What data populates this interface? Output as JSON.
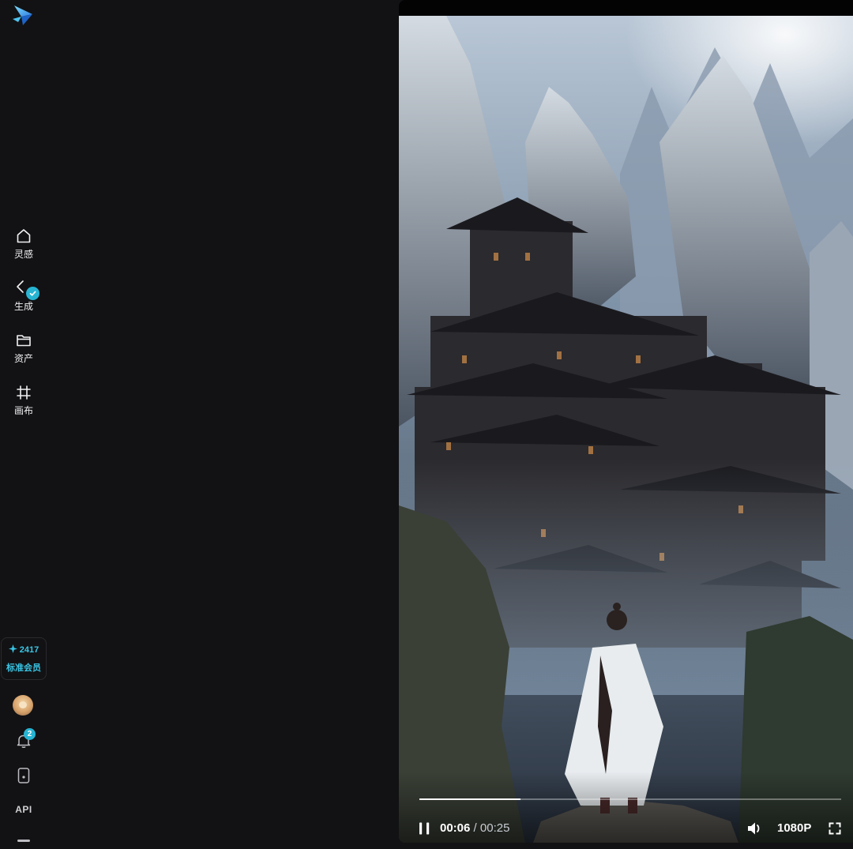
{
  "app": {
    "logo_icon": "paper-plane-logo-icon"
  },
  "sidebar": {
    "nav": [
      {
        "label": "灵感",
        "icon": "home-icon"
      },
      {
        "label": "生成",
        "icon": "generate-spark-icon",
        "badge_icon": "check-badge-icon"
      },
      {
        "label": "资产",
        "icon": "folder-icon"
      },
      {
        "label": "画布",
        "icon": "canvas-crop-icon"
      }
    ],
    "credits": {
      "icon": "sparkle-icon",
      "value": "2417",
      "member_label": "标准会员"
    },
    "notifications": {
      "icon": "bell-icon",
      "count": "2"
    },
    "mobile_icon": "mobile-phone-icon",
    "api_label": "API",
    "menu_icon": "menu-icon"
  },
  "player": {
    "current_time": "00:06",
    "separator": "/",
    "duration": "00:25",
    "progress_fraction": 0.24,
    "quality": "1080P",
    "state_icon": "pause-icon",
    "volume_icon": "volume-icon",
    "fullscreen_icon": "fullscreen-icon"
  },
  "colors": {
    "accent": "#27b4d3",
    "sidebar_bg": "#121214",
    "player_bg": "#030304"
  }
}
